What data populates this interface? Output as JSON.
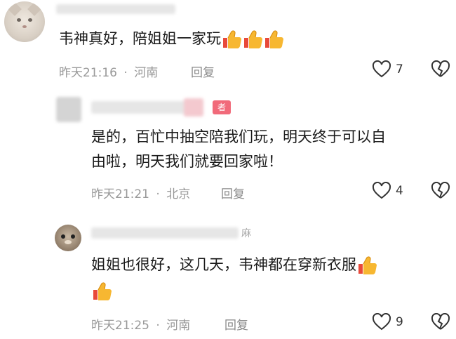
{
  "comments": [
    {
      "text": "韦神真好，陪姐姐一家玩",
      "time": "昨天21:16",
      "location": "河南",
      "reply_label": "回复",
      "likes": "7",
      "emoji": [
        "thumbs-up",
        "thumbs-up",
        "thumbs-up"
      ]
    },
    {
      "badge": "者",
      "text_line1": "是的，百忙中抽空陪我们玩，明天终于可以自",
      "text_line2": "由啦，明天我们就要回家啦！",
      "time": "昨天21:21",
      "location": "北京",
      "reply_label": "回复",
      "likes": "4"
    },
    {
      "name_fragment": "麻",
      "text_line1": "姐姐也很好，这几天，韦神都在穿新衣服",
      "time": "昨天21:25",
      "location": "河南",
      "reply_label": "回复",
      "likes": "9",
      "emoji": [
        "thumbs-up",
        "thumbs-up"
      ]
    }
  ],
  "separator": "·",
  "colors": {
    "meta": "#999999",
    "badge": "#f16a7a",
    "thumb": "#f5a623"
  }
}
